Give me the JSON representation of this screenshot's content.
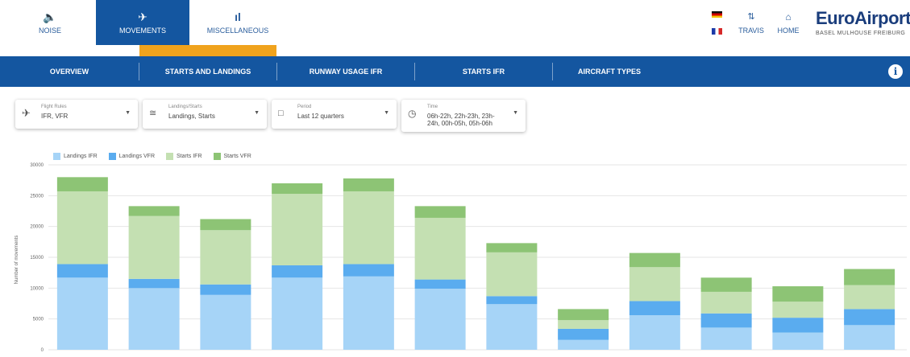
{
  "topnav": {
    "items": [
      {
        "key": "noise",
        "label": "NOISE",
        "icon": "volume-icon"
      },
      {
        "key": "movements",
        "label": "MOVEMENTS",
        "icon": "airplane-icon"
      },
      {
        "key": "misc",
        "label": "MISCELLANEOUS",
        "icon": "bar-chart-icon"
      }
    ],
    "travis_label": "TRAVIS",
    "home_label": "HOME",
    "logo_text": "EuroAirport",
    "logo_sub": "BASEL  MULHOUSE  FREIBURG"
  },
  "subnav": {
    "items": [
      "OVERVIEW",
      "STARTS AND LANDINGS",
      "RUNWAY USAGE IFR",
      "STARTS IFR",
      "AIRCRAFT TYPES"
    ],
    "info_label": "i"
  },
  "filters": [
    {
      "label": "Flight Rules",
      "value": "IFR, VFR",
      "icon": "airplane-icon"
    },
    {
      "label": "Landings/Starts",
      "value": "Landings, Starts",
      "icon": "landing-icon"
    },
    {
      "label": "Period",
      "value": "Last 12 quarters",
      "icon": "calendar-icon"
    },
    {
      "label": "Time",
      "value": "06h-22h, 22h-23h, 23h-24h, 00h-05h, 05h-06h",
      "icon": "clock-icon"
    }
  ],
  "colors": {
    "primary": "#1456a0",
    "accent": "#f0a31d",
    "landings_ifr": "#a6d4f7",
    "landings_vfr": "#5aacef",
    "starts_ifr": "#c4e0b2",
    "starts_vfr": "#8dc475"
  },
  "chart_data": {
    "type": "bar",
    "stacked": true,
    "ylabel": "Number of movements",
    "ylim": [
      0,
      30000
    ],
    "yticks": [
      0,
      5000,
      10000,
      15000,
      20000,
      25000,
      30000
    ],
    "grid": true,
    "legend_position": "top-left",
    "categories": [
      "",
      "",
      "",
      "",
      "",
      "",
      "",
      "",
      "",
      "",
      "",
      ""
    ],
    "series": [
      {
        "name": "Landings IFR",
        "values": [
          11700,
          10000,
          8900,
          11700,
          11900,
          9900,
          7400,
          1600,
          5600,
          3600,
          2800,
          4000
        ]
      },
      {
        "name": "Landings VFR",
        "values": [
          2200,
          1500,
          1700,
          2000,
          2000,
          1500,
          1300,
          1800,
          2300,
          2300,
          2400,
          2600
        ]
      },
      {
        "name": "Starts IFR",
        "values": [
          11800,
          10200,
          8800,
          11600,
          11800,
          10000,
          7100,
          1400,
          5500,
          3500,
          2600,
          3900
        ]
      },
      {
        "name": "Starts VFR",
        "values": [
          2300,
          1600,
          1800,
          1700,
          2100,
          1900,
          1500,
          1800,
          2300,
          2300,
          2500,
          2600
        ]
      }
    ]
  }
}
